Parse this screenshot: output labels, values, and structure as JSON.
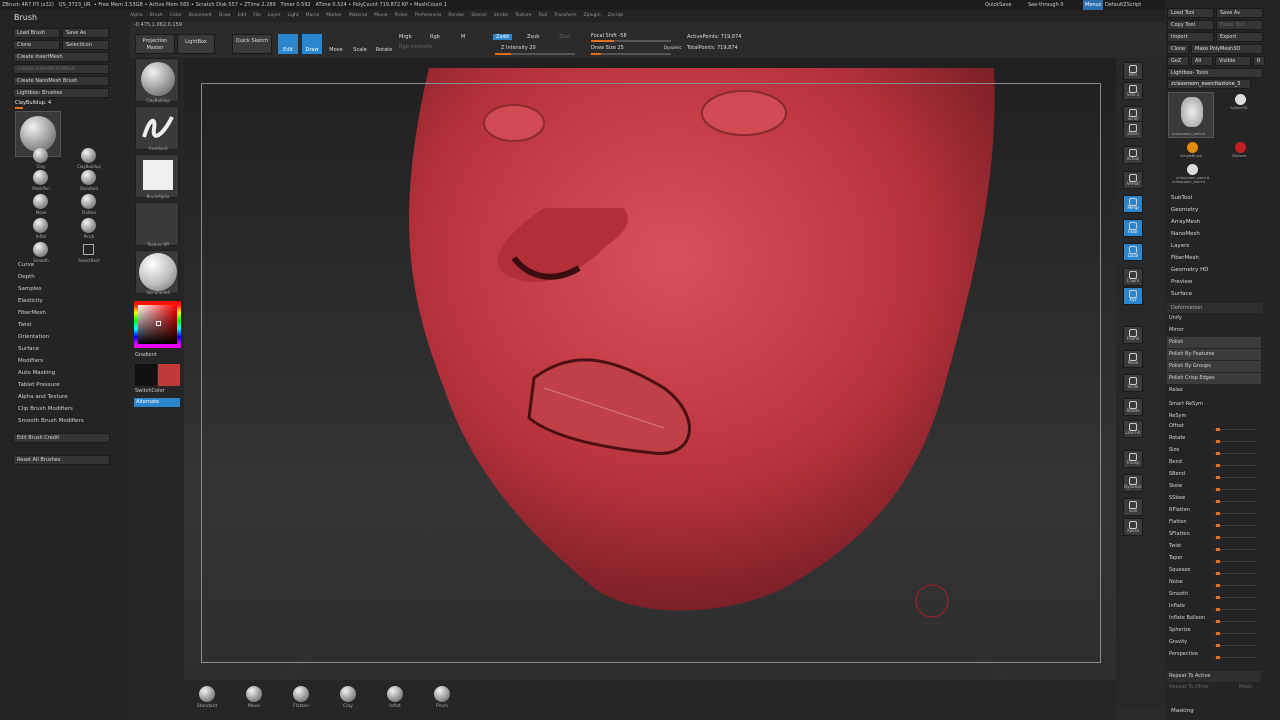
{
  "status": {
    "app": "ZBrush 4R7 P3 (x32)",
    "file": "QS_3723_UR",
    "free_mem": "Free Mem 3.53GB",
    "active_mem": "Active Mem 565",
    "scratch": "Scratch Disk 557",
    "ztime": "ZTime 2.289",
    "timer": "Timer 0.592",
    "atime": "ATime 0.524",
    "polycount": "PolyCount 719.872 KP",
    "meshcount": "MeshCount 1"
  },
  "top_right": {
    "quicksave": "QuickSave",
    "see_through": "See-through 0",
    "menus": "Menus",
    "script": "DefaultZScript"
  },
  "menubar": [
    "Alpha",
    "Brush",
    "Color",
    "Document",
    "Draw",
    "Edit",
    "File",
    "Layer",
    "Light",
    "Macro",
    "Marker",
    "Material",
    "Movie",
    "Picker",
    "Preferences",
    "Render",
    "Stencil",
    "Stroke",
    "Texture",
    "Tool",
    "Transform",
    "Zplugin",
    "Zscript"
  ],
  "coords": "-0.475,1.062,0.159",
  "left": {
    "title": "Brush",
    "load": "Load Brush",
    "save": "Save As",
    "clone": "Clone",
    "select_icon": "SelectIcon",
    "create_insert": "Create InsertMesh",
    "create_insert_multi": "Create InsertMultiMesh",
    "create_nano": "Create NanoMesh Brush",
    "lightbox_brushes": "Lightbox› Brushes",
    "current_brush": "ClayBuildup. 4",
    "brushes": [
      "ClayBuildup",
      "Clay",
      "ClayBuildup",
      "MaskPen",
      "Standard",
      "Move",
      "Flatten",
      "Inflat",
      "Pinch",
      "Smooth",
      "SelectRect"
    ],
    "sections": [
      "Curve",
      "Depth",
      "Samples",
      "Elasticity",
      "FiberMesh",
      "Twist",
      "Orientation",
      "Surface",
      "Modifiers",
      "Auto Masking",
      "Tablet Pressure",
      "Alpha and Texture",
      "Clip Brush Modifiers",
      "Smooth Brush Modifiers"
    ],
    "edit_credit": "Edit Brush Credit",
    "reset": "Reset All Brushes"
  },
  "tiles": {
    "brush": "ClayBuildup",
    "stroke": "FreeHand",
    "alpha": "BrushAlpha",
    "texture": "Texture Off",
    "material": "SkinShade4",
    "gradient": "Gradient",
    "switch": "SwitchColor",
    "alternate": "Alternate"
  },
  "toolbar": {
    "projection": "Projection Master",
    "lightbox": "LightBox",
    "quick_sketch": "Quick Sketch",
    "edit": "Edit",
    "draw": "Draw",
    "move": "Move",
    "scale": "Scale",
    "rotate": "Rotate",
    "mrgb": "Mrgb",
    "rgb": "Rgb",
    "m": "M",
    "rgb_intensity": "Rgb Intensity",
    "zadd": "Zadd",
    "zsub": "Zsub",
    "zcut": "Zcut",
    "z_intensity": "Z Intensity 20",
    "focal_shift": "Focal Shift -58",
    "draw_size": "Draw Size 25",
    "dynamic": "Dynamic",
    "active_points": "ActivePoints: 719,874",
    "total_points": "TotalPoints: 719,874"
  },
  "right_shelf": [
    "BPR",
    "SPix 3",
    "Scroll",
    "Zoom",
    "Actual",
    "AAHalf",
    "Persp",
    "Floor",
    "Local",
    "L.Sym",
    "Xyz",
    "Frame",
    "Move",
    "Scale",
    "Rotate",
    "Line Fill PolyF",
    "Transp",
    "Dynamic",
    "Solo",
    "Xpose"
  ],
  "tool_panel": {
    "load": "Load Tool",
    "save": "Save As",
    "copy": "Copy Tool",
    "paste": "Paste Tool",
    "import": "Import",
    "export": "Export",
    "clone": "Clone",
    "make_poly": "Make PolyMesh3D",
    "goz": "GoZ",
    "all": "All",
    "visible": "Visible",
    "r": "R",
    "lightbox_tools": "Lightbox› Tools",
    "current_tool": "zclassroom_esercitazione_3",
    "tools": [
      "zclassroom_esercit",
      "Sphere3D",
      "SimpleBrush",
      "ZSphere",
      "zclassroom_esercit",
      "zclassroom_esercit"
    ]
  },
  "tool_sections": [
    "SubTool",
    "Geometry",
    "ArrayMesh",
    "NanoMesh",
    "Layers",
    "FiberMesh",
    "Geometry HD",
    "Preview",
    "Surface"
  ],
  "deformation": {
    "header": "Deformation",
    "top_rows": [
      "Unify",
      "Mirror",
      "Polish",
      "Polish By Features",
      "Polish By Groups",
      "Polish Crisp Edges",
      "Relax"
    ],
    "smart_resym": "Smart ReSym",
    "resym": "ReSym",
    "sliders": [
      "Offset",
      "Rotate",
      "Size",
      "Bend",
      "SBend",
      "Skew",
      "SSkew",
      "RFlatten",
      "Flatten",
      "SFlatten",
      "Twist",
      "Taper",
      "Squeeze",
      "Noise",
      "Smooth",
      "Inflate",
      "Inflate Balloon",
      "Spherize",
      "Gravity",
      "Perspective"
    ],
    "repeat_active": "Repeat To Active",
    "repeat_other": "Repeat To Other",
    "mesh": "Mesh"
  },
  "masking": "Masking",
  "bottom_brushes": [
    "Standard",
    "Move",
    "Flatten",
    "Clay",
    "Inflat",
    "Pinch"
  ],
  "colors": {
    "accent": "#2b86d0",
    "slider": "#e07020",
    "model": "#c2353f",
    "primary": "#111111",
    "secondary": "#c03a3a"
  }
}
